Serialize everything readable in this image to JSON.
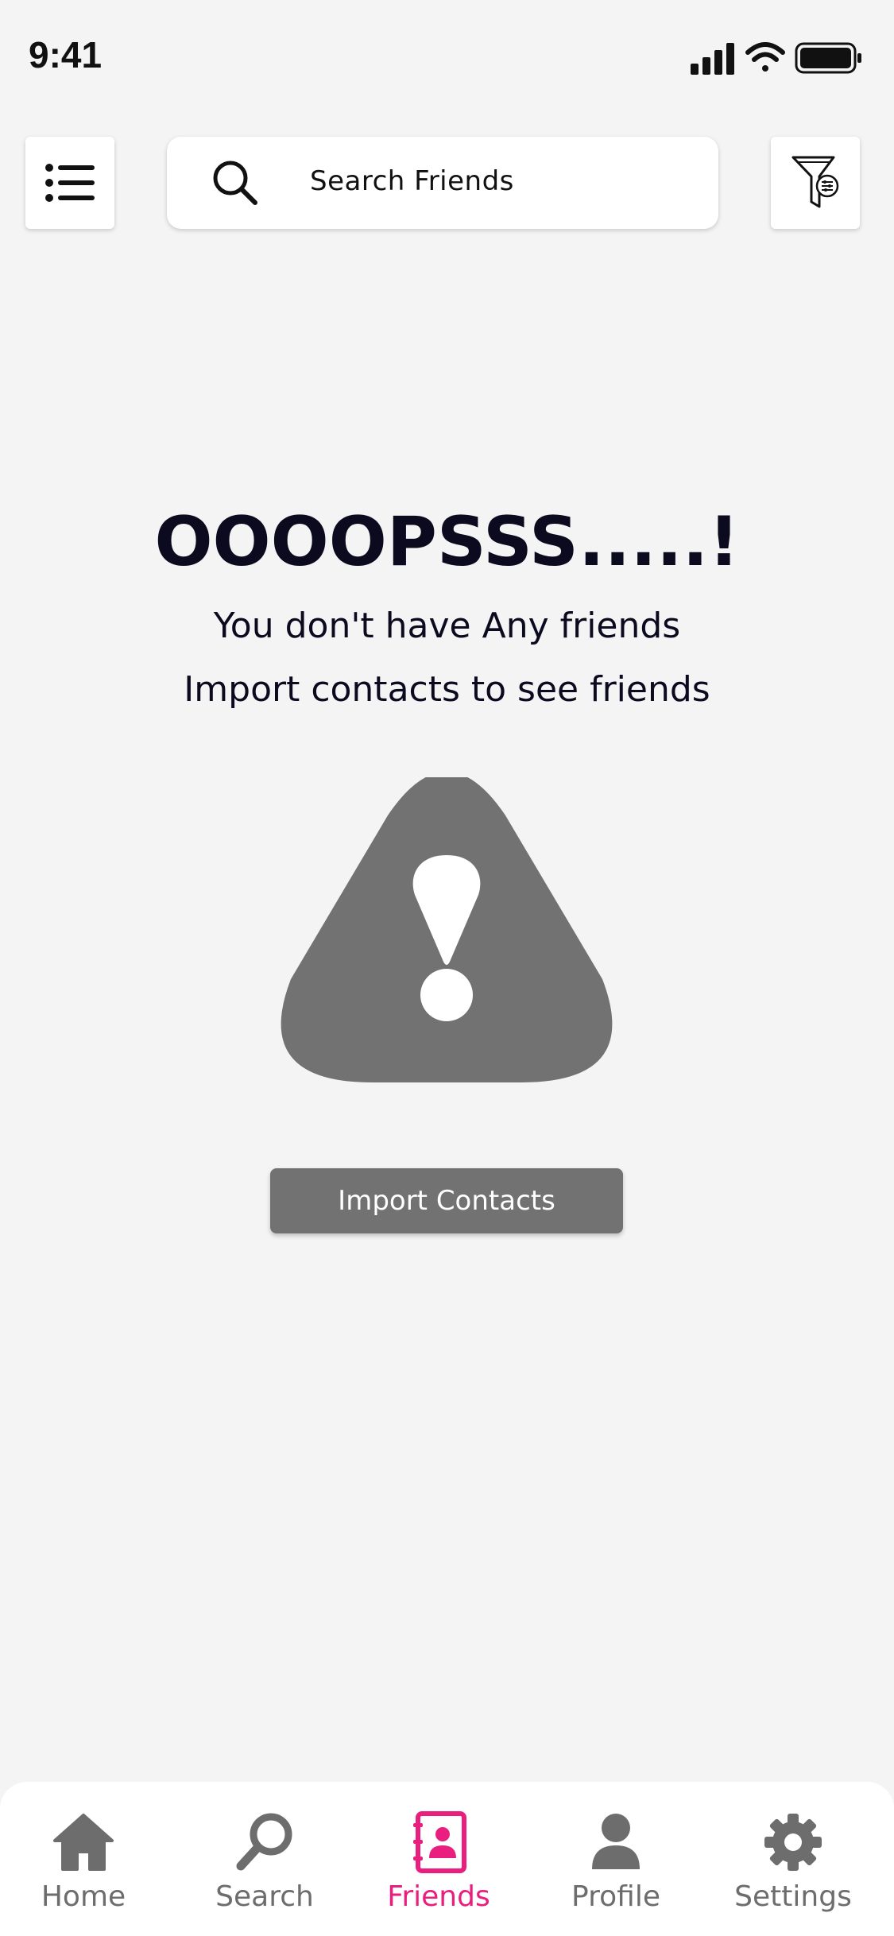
{
  "status_bar": {
    "time": "9:41"
  },
  "header": {
    "search_placeholder": "Search Friends",
    "menu_icon": "list-icon",
    "filter_icon": "funnel-settings-icon"
  },
  "empty_state": {
    "title": "OOOOPSSS.....!",
    "line1": "You don't have Any friends",
    "line2": "Import contacts to see friends",
    "icon": "warning-triangle-icon",
    "button_label": "Import Contacts"
  },
  "tabbar": {
    "items": [
      {
        "label": "Home",
        "icon": "home-icon"
      },
      {
        "label": "Search",
        "icon": "search-icon"
      },
      {
        "label": "Friends",
        "icon": "contacts-book-icon",
        "active": true
      },
      {
        "label": "Profile",
        "icon": "person-icon"
      },
      {
        "label": "Settings",
        "icon": "gear-icon"
      }
    ]
  },
  "colors": {
    "background": "#f4f4f4",
    "accent": "#e91e7f",
    "inactive": "#6d6d6d",
    "button": "#727272",
    "text_dark": "#0c0a1f"
  }
}
